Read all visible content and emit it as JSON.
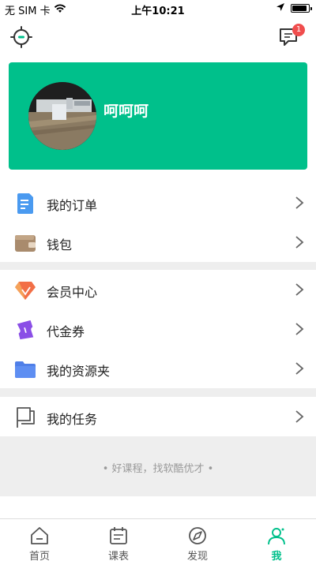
{
  "status_bar": {
    "carrier": "无 SIM 卡",
    "time": "上午10:21",
    "battery_level": 0.9
  },
  "header": {
    "settings_icon": "settings-gear-icon",
    "messages_icon": "message-bubble-icon",
    "message_badge": "1"
  },
  "profile": {
    "username": "呵呵呵",
    "card_color": "#00c08b"
  },
  "menu": {
    "group1": [
      {
        "label": "我的订单",
        "icon": "order-document-icon"
      },
      {
        "label": "钱包",
        "icon": "wallet-icon"
      }
    ],
    "group2": [
      {
        "label": "会员中心",
        "icon": "member-gem-icon"
      },
      {
        "label": "代金券",
        "icon": "voucher-ticket-icon"
      },
      {
        "label": "我的资源夹",
        "icon": "folder-icon"
      }
    ],
    "group3": [
      {
        "label": "我的任务",
        "icon": "task-flag-icon"
      }
    ]
  },
  "footer": {
    "slogan": "• 好课程，找软酷优才 •"
  },
  "tabs": [
    {
      "label": "首页",
      "icon": "home-icon",
      "active": false
    },
    {
      "label": "课表",
      "icon": "calendar-icon",
      "active": false
    },
    {
      "label": "发现",
      "icon": "discover-compass-icon",
      "active": false
    },
    {
      "label": "我",
      "icon": "profile-person-icon",
      "active": true
    }
  ],
  "colors": {
    "accent": "#00c08b",
    "badge": "#f04d4d",
    "divider": "#eeeeee"
  }
}
